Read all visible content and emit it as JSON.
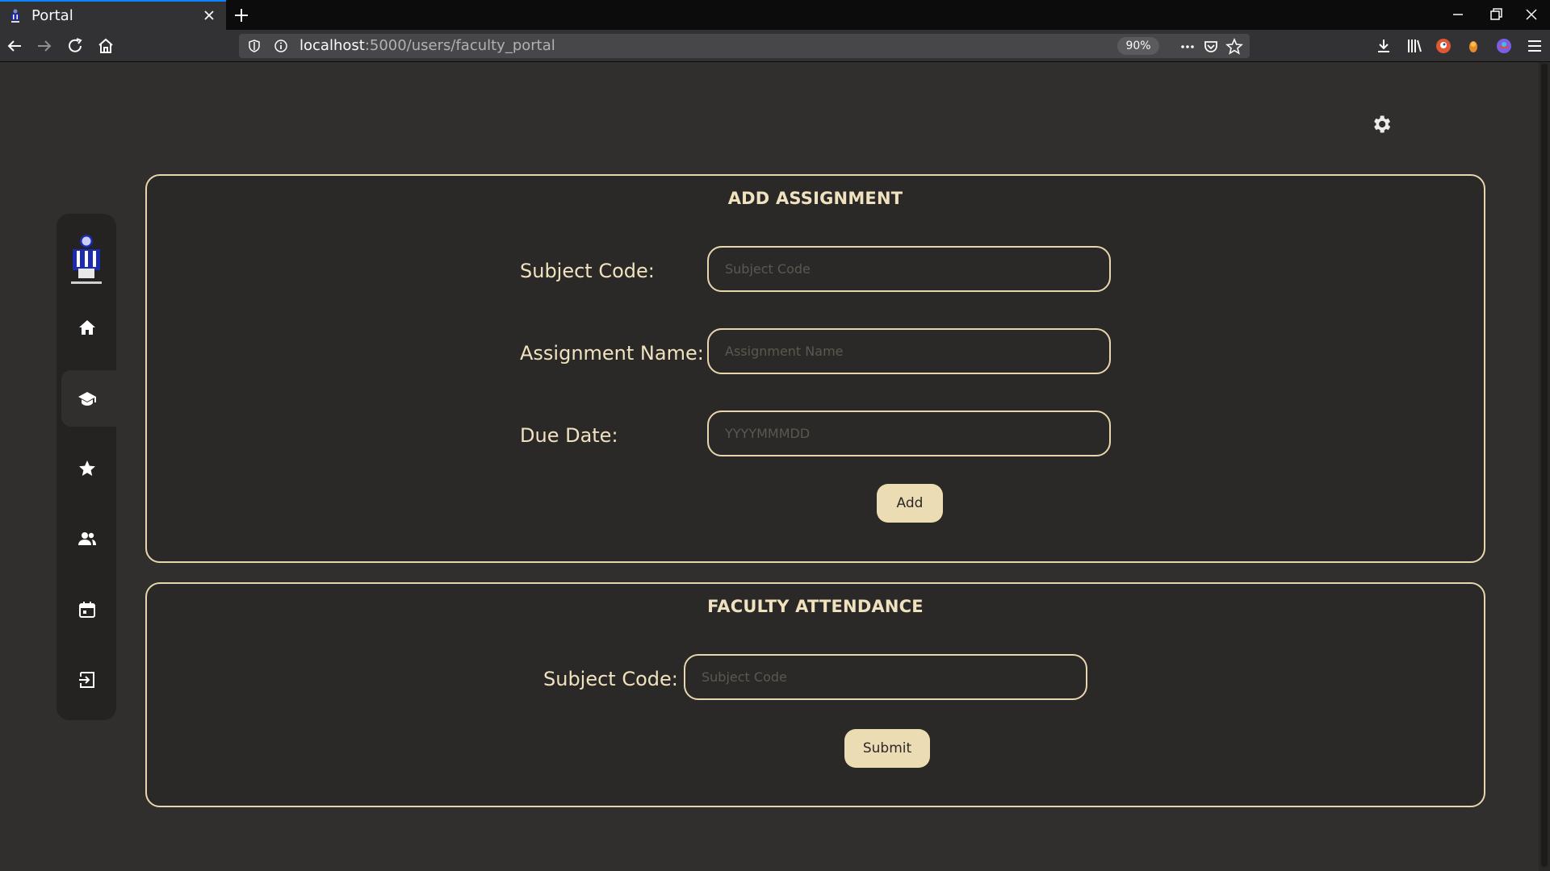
{
  "browser": {
    "tab_title": "Portal",
    "url_host": "localhost",
    "url_path": ":5000/users/faculty_portal",
    "zoom": "90%"
  },
  "assignment": {
    "title": "ADD ASSIGNMENT",
    "subject_code_label": "Subject Code:",
    "subject_code_placeholder": "Subject Code",
    "assignment_name_label": "Assignment Name:",
    "assignment_name_placeholder": "Assignment Name",
    "due_date_label": "Due Date:",
    "due_date_placeholder": "YYYYMMMDD",
    "add_label": "Add"
  },
  "attendance": {
    "title": "FACULTY ATTENDANCE",
    "subject_code_label": "Subject Code:",
    "subject_code_placeholder": "Subject Code",
    "submit_label": "Submit"
  },
  "sidebar": {
    "items": [
      {
        "icon": "home-icon"
      },
      {
        "icon": "graduation-cap-icon",
        "active": true
      },
      {
        "icon": "star-icon"
      },
      {
        "icon": "users-icon"
      },
      {
        "icon": "calendar-icon"
      },
      {
        "icon": "logout-icon"
      }
    ]
  },
  "colors": {
    "page_background": "#312f2d",
    "accent": "#e8d6ad",
    "button": "#ecdcb3",
    "sidebar": "#252321"
  }
}
